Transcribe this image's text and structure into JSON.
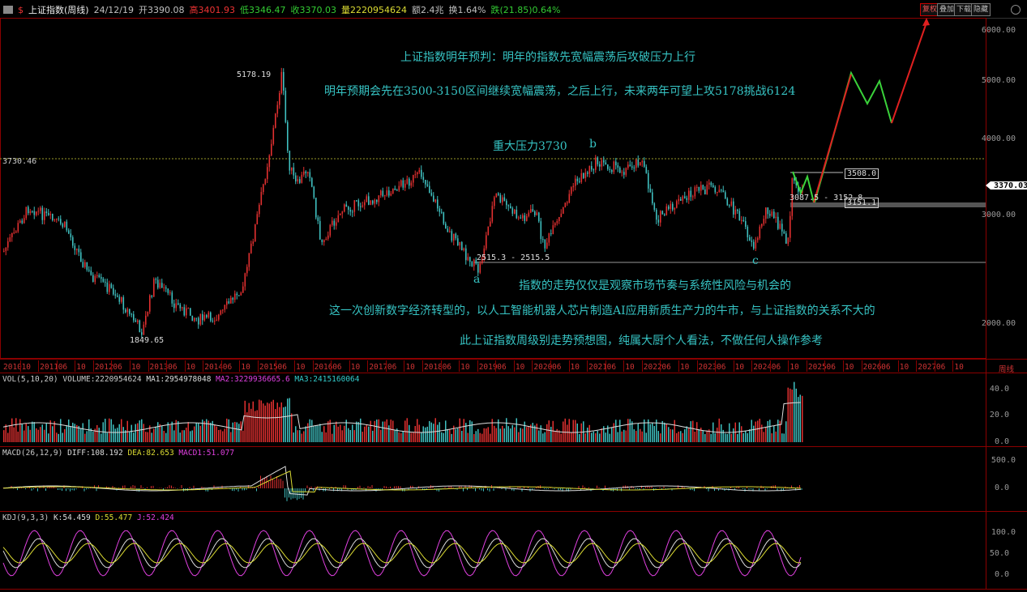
{
  "header": {
    "symbol_name": "上证指数(周线)",
    "date": "24/12/19",
    "open": "开3390.08",
    "high": "高3401.93",
    "low": "低3346.47",
    "close": "收3370.03",
    "volume": "量2220954624",
    "amount": "额2.4兆",
    "turnover": "换1.64%",
    "change": "跌(21.85)0.64%",
    "buttons": [
      "复权",
      "叠加",
      "下载",
      "隐藏"
    ]
  },
  "price_axis": {
    "labels": [
      "6000.00",
      "5000.00",
      "4000.00",
      "3000.00",
      "2000.00"
    ],
    "current_price": "3370.03",
    "level_line": "3730.46"
  },
  "annotations": {
    "line1": "上证指数明年预判：明年的指数先宽幅震荡后攻破压力上行",
    "line2": "明年预期会先在3500-3150区间继续宽幅震荡，之后上行，未来两年可望上攻5178挑战6124",
    "line3": "重大压力3730",
    "label_b": "b",
    "label_a": "a",
    "label_c": "c",
    "line4": "指数的走势仅仅是观察市场节奏与系统性风险与机会的",
    "line5": "这一次创新数字经济转型的，以人工智能机器人芯片制造AI应用新质生产力的牛市，与上证指数的关系不大的",
    "line6": "此上证指数周级别走势预想图，纯属大厨个人看法，不做任何人操作参考",
    "peak": "5178.19",
    "bottom": "1849.65",
    "range_a": "2515.3 - 2515.5",
    "range_recent": "3087.5 - 3152.8",
    "box_3508": "3508.0",
    "box_3151": "3151.1"
  },
  "x_axis": {
    "labels": [
      "2010",
      "10",
      "2011",
      "06",
      "10",
      "2012",
      "06",
      "10",
      "2013",
      "06",
      "10",
      "2014",
      "06",
      "10",
      "2015",
      "06",
      "10",
      "2016",
      "06",
      "10",
      "2017",
      "06",
      "10",
      "2018",
      "06",
      "10",
      "2019",
      "06",
      "10",
      "2020",
      "06",
      "10",
      "2021",
      "06",
      "10",
      "2022",
      "06",
      "10",
      "2023",
      "06",
      "10",
      "2024",
      "06",
      "10",
      "2025",
      "06",
      "10",
      "2026",
      "06",
      "10",
      "2027",
      "06",
      "10"
    ],
    "period": "周线"
  },
  "volume_panel": {
    "title": "VOL(5,10,20)",
    "volume": "VOLUME:2220954624",
    "ma1": "MA1:2954978048",
    "ma2": "MA2:3229936665.6",
    "ma3": "MA3:2415160064",
    "axis": [
      "40.0",
      "20.0",
      "0.0"
    ]
  },
  "macd_panel": {
    "title": "MACD(26,12,9)",
    "diff": "DIFF:108.192",
    "dea": "DEA:82.653",
    "macd": "MACD1:51.077",
    "axis": [
      "500.0",
      "0.0"
    ]
  },
  "kdj_panel": {
    "title": "KDJ(9,3,3)",
    "k": "K:54.459",
    "d": "D:55.477",
    "j": "J:52.424",
    "axis": [
      "100.0",
      "50.0",
      "0.0"
    ]
  },
  "colors": {
    "up": "#e23030",
    "down": "#3fbfbf",
    "annotation": "#36c3c3",
    "forecast_up": "#e02020",
    "forecast_down": "#39d039"
  }
}
